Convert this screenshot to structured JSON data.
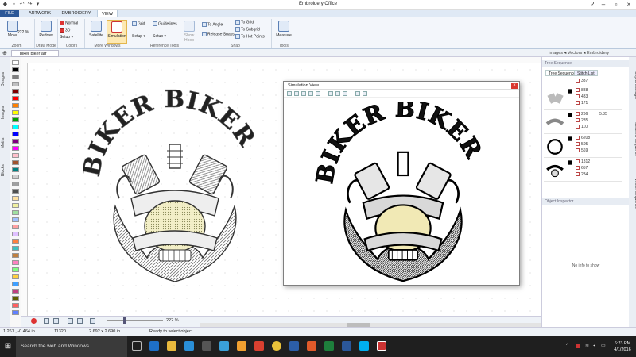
{
  "app": {
    "title": "Embroidery Office"
  },
  "ribbon_tabs": [
    {
      "label": "FILE"
    },
    {
      "label": "ARTWORK"
    },
    {
      "label": "EMBROIDERY"
    },
    {
      "label": "VIEW"
    }
  ],
  "ribbon": {
    "zoom_group": {
      "label": "Zoom",
      "move_label": "Move",
      "zoom_value": "222 %"
    },
    "draw_group": {
      "label": "Draw Mode",
      "redraw_label": "Redraw"
    },
    "colors_group": {
      "label": "Colors",
      "normal_label": "Normal",
      "3d_label": "3D",
      "setup_label": "Setup"
    },
    "windows_group": {
      "label": "More Windows",
      "satellite_label": "Satellite",
      "simulation_label": "Simulation"
    },
    "reference_group": {
      "label": "Reference Tools",
      "grid_label": "Grid",
      "guidelines_label": "Guidelines",
      "setup1_label": "Setup",
      "setup2_label": "Setup",
      "show_hoop_label": "Show Hoop"
    },
    "snap_group": {
      "label": "Snap",
      "to_angle_label": "To Angle",
      "release_snaps_label": "Release Snaps",
      "to_grid_label": "To Grid",
      "to_subgrid_label": "To Subgrid",
      "to_hot_points_label": "To Hot Points"
    },
    "tools_group": {
      "label": "Tools",
      "measure_label": "Measure"
    }
  },
  "document": {
    "tab_label": "biker biker arr borde",
    "side_path": "Images  ◂  Vectors  ◂  Embroidery"
  },
  "left_vtabs": [
    "Designs",
    "Images",
    "Motifs",
    "Blocks"
  ],
  "palette_colors": [
    "#ffffff",
    "#000000",
    "#7f7f7f",
    "#c0c0c0",
    "#800000",
    "#ff0000",
    "#ff8000",
    "#ffff00",
    "#00a000",
    "#00ffff",
    "#0000ff",
    "#800080",
    "#ff00ff",
    "#ffc0cb",
    "#a0522d",
    "#008080",
    "#d0d0d0",
    "#a0a0a0",
    "#505050",
    "#ffe0a0",
    "#f0f0a0",
    "#a0e0a0",
    "#a0c0ff",
    "#ffa0a0",
    "#e0c0ff",
    "#ff8040",
    "#40c0c0",
    "#c08040",
    "#ff80c0",
    "#80ff80",
    "#ffd040",
    "#40a0ff",
    "#c04080",
    "#606000",
    "#ff6060",
    "#6080ff"
  ],
  "simulation": {
    "title": "Simulation View",
    "close_label": "×"
  },
  "design_text": "BIKER BIKER",
  "bottombar": {
    "zoom_value": "222 %"
  },
  "status": {
    "coords": "1.267 , -0.464 in",
    "stitches": "11320",
    "size": "2.692 x 2.690 in",
    "message": "Ready to select object"
  },
  "right_panel": {
    "tree_header": "Tree Sequence",
    "tabs": [
      "Tree Sequence",
      "Stitch List"
    ],
    "rows": [
      {
        "v1": "337",
        "v2": "",
        "v3": ""
      },
      {
        "v1": "888",
        "v2": "433",
        "v3": "171"
      },
      {
        "v1": "266",
        "v2": "285",
        "v3": "110",
        "angle": "5.35"
      },
      {
        "v1": "6208",
        "v2": "505",
        "v3": "569"
      },
      {
        "v1": "1812",
        "v2": "657",
        "v3": "284"
      }
    ],
    "inspector_header": "Object Inspector",
    "inspector_empty": "No info to show",
    "vtabs": [
      "Object Manager",
      "Sections Sequence",
      "Vector Sequence"
    ]
  },
  "taskbar": {
    "search_placeholder": "Search the web and Windows",
    "time": "6:23 PM",
    "date": "4/1/2016"
  }
}
